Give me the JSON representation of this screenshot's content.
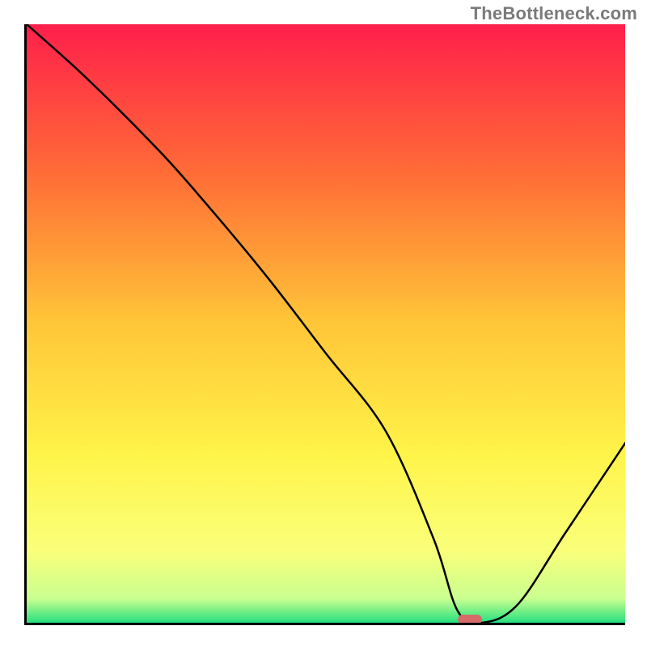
{
  "watermark": "TheBottleneck.com",
  "chart_data": {
    "type": "line",
    "title": "",
    "xlabel": "",
    "ylabel": "",
    "xlim": [
      0,
      100
    ],
    "ylim": [
      0,
      100
    ],
    "grid": false,
    "legend": false,
    "background_gradient": {
      "stops": [
        {
          "offset": 0,
          "color": "#ff1f4b"
        },
        {
          "offset": 25,
          "color": "#ff6c36"
        },
        {
          "offset": 50,
          "color": "#ffc638"
        },
        {
          "offset": 72,
          "color": "#fff449"
        },
        {
          "offset": 88,
          "color": "#faff7a"
        },
        {
          "offset": 96,
          "color": "#c9ff90"
        },
        {
          "offset": 100,
          "color": "#25e07e"
        }
      ]
    },
    "series": [
      {
        "name": "bottleneck-curve",
        "color": "#000000",
        "x": [
          0,
          10,
          22,
          30,
          40,
          50,
          60,
          68,
          72,
          76,
          82,
          90,
          100
        ],
        "y": [
          100,
          91,
          79,
          70,
          58,
          45,
          32,
          14,
          2,
          0,
          3,
          15,
          30
        ]
      }
    ],
    "marker": {
      "name": "optimal-point",
      "color": "#d66a6a",
      "x": 74,
      "y": 0
    }
  }
}
